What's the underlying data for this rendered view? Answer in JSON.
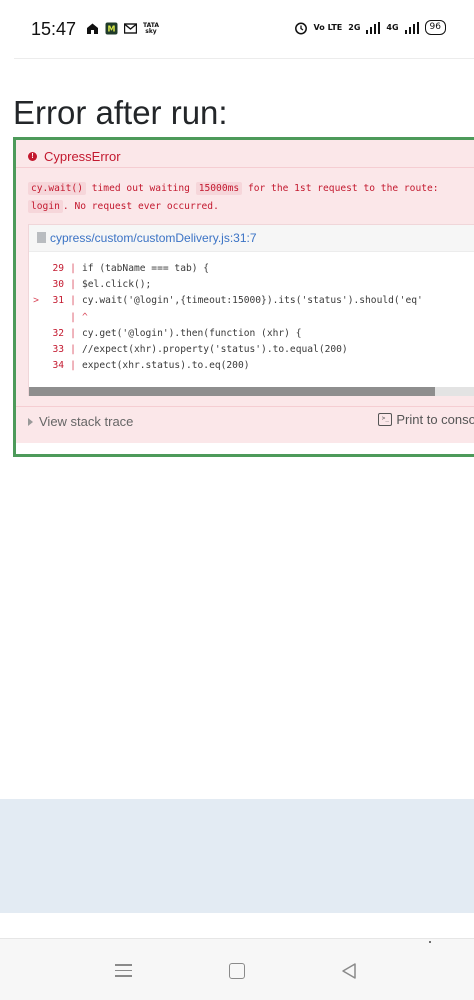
{
  "status_bar": {
    "time": "15:47",
    "carrier_logo_text": "TATA sky",
    "network_labels": [
      "Vo LTE",
      "2G",
      "4G"
    ],
    "battery": "96",
    "icons": [
      "home-icon",
      "messages-app-icon",
      "gmail-icon",
      "alarm-icon",
      "signal-icon"
    ]
  },
  "heading": "Error after run:",
  "error": {
    "title": "CypressError",
    "message": {
      "chip1": "cy.wait()",
      "text1": " timed out waiting ",
      "chip2": "15000ms",
      "text2": " for the 1st request to the route:",
      "chip3": "login",
      "text3": ". No request ever occurred."
    },
    "file_link": "cypress/custom/customDelivery.js:31:7",
    "code_lines": [
      {
        "num": "29",
        "marker": "",
        "code": "    if (tabName === tab) {"
      },
      {
        "num": "30",
        "marker": "",
        "code": "    $el.click();"
      },
      {
        "num": "31",
        "marker": ">",
        "code": "    cy.wait('@login',{timeout:15000}).its('status').should('eq'"
      },
      {
        "num": "",
        "marker": "",
        "code": "      ^"
      },
      {
        "num": "32",
        "marker": "",
        "code": "    cy.get('@login').then(function (xhr) {"
      },
      {
        "num": "33",
        "marker": "",
        "code": "    //expect(xhr).property('status').to.equal(200)"
      },
      {
        "num": "34",
        "marker": "",
        "code": "    expect(xhr.status).to.eq(200)"
      }
    ],
    "stack_trace_label": "View stack trace",
    "console_label": "Print to console"
  },
  "nav": {
    "icons": [
      "recent-apps-icon",
      "home-button-icon",
      "back-icon"
    ]
  }
}
